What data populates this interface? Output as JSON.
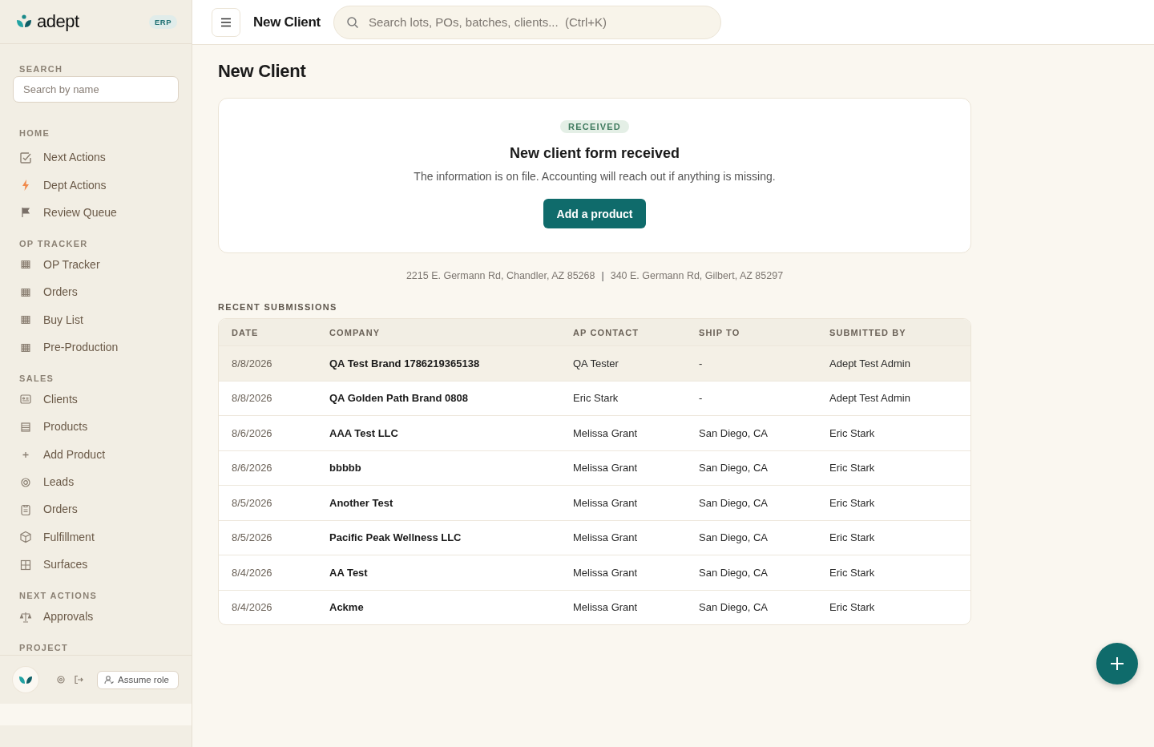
{
  "sidebar": {
    "logo": "adept",
    "badge": "ERP",
    "search": {
      "label": "SEARCH",
      "placeholder": "Search by name"
    },
    "sections": [
      {
        "label": "HOME",
        "items": [
          {
            "label": "Next Actions",
            "kind": "check"
          },
          {
            "label": "Dept Actions",
            "kind": "bolt"
          },
          {
            "label": "Review Queue",
            "kind": "flag"
          }
        ]
      },
      {
        "label": "OP TRACKER",
        "items": [
          {
            "label": "OP Tracker",
            "kind": "table"
          },
          {
            "label": "Orders",
            "kind": "table"
          },
          {
            "label": "Buy List",
            "kind": "table"
          },
          {
            "label": "Pre-Production",
            "kind": "table"
          }
        ]
      },
      {
        "label": "SALES",
        "items": [
          {
            "label": "Clients",
            "kind": "card"
          },
          {
            "label": "Products",
            "kind": "list"
          },
          {
            "label": "Add Product",
            "kind": "plus"
          },
          {
            "label": "Leads",
            "kind": "target"
          },
          {
            "label": "Orders",
            "kind": "clipboard"
          },
          {
            "label": "Fulfillment",
            "kind": "box"
          },
          {
            "label": "Surfaces",
            "kind": "grid"
          }
        ]
      },
      {
        "label": "NEXT ACTIONS",
        "items": [
          {
            "label": "Approvals",
            "kind": "scale"
          }
        ]
      },
      {
        "label": "PROJECT"
      }
    ],
    "footer": {
      "button": "Assume role"
    }
  },
  "topbar": {
    "title": "New Client",
    "search_placeholder": "Search lots, POs, batches, clients...  (Ctrl+K)"
  },
  "page": {
    "title": "New Client",
    "card": {
      "badge": "RECEIVED",
      "heading": "New client form received",
      "message": "The information is on file. Accounting will reach out if anything is missing.",
      "button": "Add a product"
    },
    "addresses": [
      "2215 E. Germann Rd, Chandler, AZ 85268",
      "|",
      "340 E. Germann Rd, Gilbert, AZ 85297"
    ],
    "table": {
      "title": "RECENT SUBMISSIONS",
      "columns": [
        "DATE",
        "COMPANY",
        "AP CONTACT",
        "SHIP TO",
        "SUBMITTED BY"
      ],
      "rows": [
        {
          "cells": [
            "8/8/2026",
            "QA Test Brand 1786219365138",
            "QA Tester",
            "-",
            "Adept Test Admin"
          ],
          "hovered": true
        },
        {
          "cells": [
            "8/8/2026",
            "QA Golden Path Brand 0808",
            "Eric Stark",
            "-",
            "Adept Test Admin"
          ],
          "hovered": false
        },
        {
          "cells": [
            "8/6/2026",
            "AAA Test LLC",
            "Melissa Grant",
            "San Diego, CA",
            "Eric Stark"
          ],
          "hovered": false
        },
        {
          "cells": [
            "8/6/2026",
            "bbbbb",
            "Melissa Grant",
            "San Diego, CA",
            "Eric Stark"
          ],
          "hovered": false
        },
        {
          "cells": [
            "8/5/2026",
            "Another Test",
            "Melissa Grant",
            "San Diego, CA",
            "Eric Stark"
          ],
          "hovered": false
        },
        {
          "cells": [
            "8/5/2026",
            "Pacific Peak Wellness LLC",
            "Melissa Grant",
            "San Diego, CA",
            "Eric Stark"
          ],
          "hovered": false
        },
        {
          "cells": [
            "8/4/2026",
            "AA Test",
            "Melissa Grant",
            "San Diego, CA",
            "Eric Stark"
          ],
          "hovered": false
        },
        {
          "cells": [
            "8/4/2026",
            "Ackme",
            "Melissa Grant",
            "San Diego, CA",
            "Eric Stark"
          ],
          "hovered": false
        }
      ]
    }
  }
}
